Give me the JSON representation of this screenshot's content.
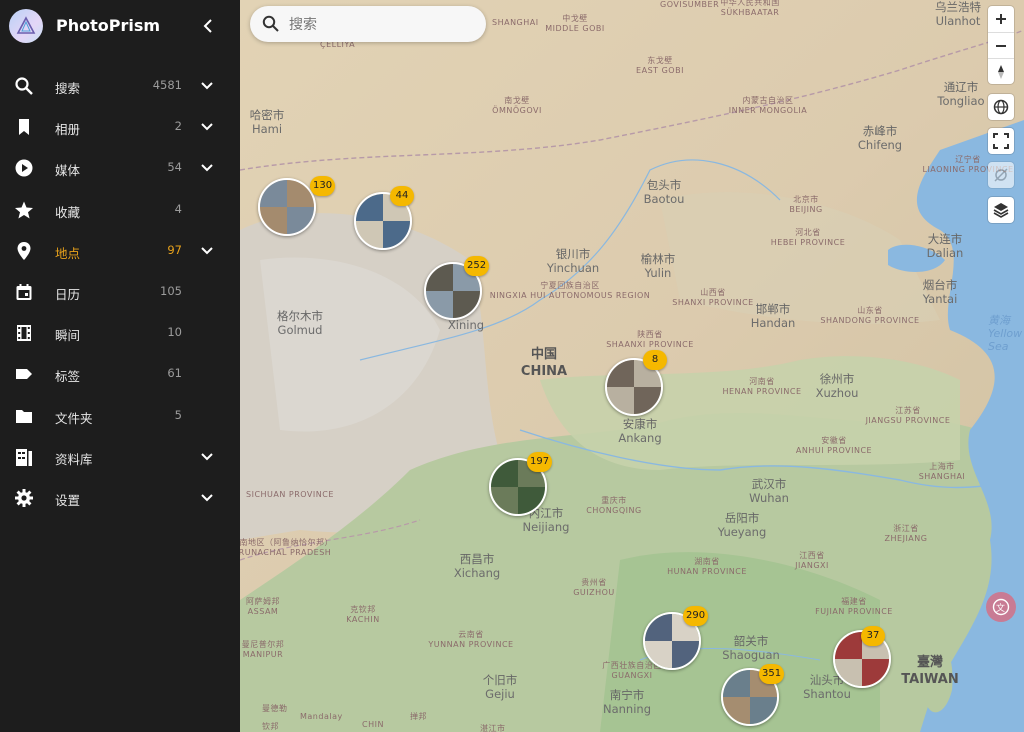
{
  "app": {
    "name": "PhotoPrism"
  },
  "nav": [
    {
      "label": "搜索",
      "count": "4581",
      "icon": "search-icon",
      "chevron": true
    },
    {
      "label": "相册",
      "count": "2",
      "icon": "bookmark-icon",
      "chevron": true
    },
    {
      "label": "媒体",
      "count": "54",
      "icon": "play-circle-icon",
      "chevron": true
    },
    {
      "label": "收藏",
      "count": "4",
      "icon": "star-icon",
      "chevron": false
    },
    {
      "label": "地点",
      "count": "97",
      "icon": "map-marker-icon",
      "chevron": true,
      "active": true
    },
    {
      "label": "日历",
      "count": "105",
      "icon": "calendar-icon",
      "chevron": false
    },
    {
      "label": "瞬间",
      "count": "10",
      "icon": "film-icon",
      "chevron": false
    },
    {
      "label": "标签",
      "count": "61",
      "icon": "label-icon",
      "chevron": false
    },
    {
      "label": "文件夹",
      "count": "5",
      "icon": "folder-icon",
      "chevron": false
    },
    {
      "label": "资料库",
      "count": "",
      "icon": "library-icon",
      "chevron": true
    },
    {
      "label": "设置",
      "count": "",
      "icon": "gear-icon",
      "chevron": true
    }
  ],
  "search": {
    "placeholder": "搜索"
  },
  "map": {
    "places": [
      {
        "zh": "哈密市",
        "en": "Hami"
      },
      {
        "zh": "格尔木市",
        "en": "Golmud"
      },
      {
        "zh": "银川市",
        "en": "Yinchuan"
      },
      {
        "zh": "包头市",
        "en": "Baotou"
      },
      {
        "zh": "榆林市",
        "en": "Yulin"
      },
      {
        "zh": "赤峰市",
        "en": "Chifeng"
      },
      {
        "zh": "大连市",
        "en": "Dalian"
      },
      {
        "zh": "烟台市",
        "en": "Yantai"
      },
      {
        "zh": "邯郸市",
        "en": "Handan"
      },
      {
        "zh": "徐州市",
        "en": "Xuzhou"
      },
      {
        "zh": "安康市",
        "en": "Ankang"
      },
      {
        "zh": "武汉市",
        "en": "Wuhan"
      },
      {
        "zh": "岳阳市",
        "en": "Yueyang"
      },
      {
        "zh": "内江市",
        "en": "Neijiang"
      },
      {
        "zh": "西昌市",
        "en": "Xichang"
      },
      {
        "zh": "韶关市",
        "en": "Shaoguan"
      },
      {
        "zh": "汕头市",
        "en": "Shantou"
      },
      {
        "zh": "南宁市",
        "en": "Nanning"
      },
      {
        "zh": "个旧市",
        "en": "Gejiu"
      },
      {
        "zh": "通辽市",
        "en": "Tongliao"
      },
      {
        "zh": "乌兰浩特",
        "en": "Ulanhot"
      }
    ],
    "partial_places": [
      {
        "zh": "",
        "en": "Xining"
      }
    ],
    "provinces": [
      {
        "zh": "中华人民共和国",
        "en": "SÜKHBAATAR"
      },
      {
        "zh": "中戈壁",
        "en": "MIDDLE GOBI"
      },
      {
        "zh": "东戈壁",
        "en": "EAST GOBI"
      },
      {
        "zh": "南戈壁",
        "en": "ÖMNÖGOVI"
      },
      {
        "zh": "内蒙古自治区",
        "en": "INNER MONGOLIA"
      },
      {
        "zh": "宁夏回族自治区",
        "en": "NINGXIA HUI AUTONOMOUS REGION"
      },
      {
        "zh": "山西省",
        "en": "SHANXI PROVINCE"
      },
      {
        "zh": "陕西省",
        "en": "SHAANXI PROVINCE"
      },
      {
        "zh": "北京市",
        "en": "BEIJING"
      },
      {
        "zh": "河北省",
        "en": "HEBEI PROVINCE"
      },
      {
        "zh": "山东省",
        "en": "SHANDONG PROVINCE"
      },
      {
        "zh": "河南省",
        "en": "HENAN PROVINCE"
      },
      {
        "zh": "江苏省",
        "en": "JIANGSU PROVINCE"
      },
      {
        "zh": "安徽省",
        "en": "ANHUI PROVINCE"
      },
      {
        "zh": "上海市",
        "en": "SHANGHAI"
      },
      {
        "zh": "重庆市",
        "en": "CHONGQING"
      },
      {
        "zh": "湖南省",
        "en": "HUNAN PROVINCE"
      },
      {
        "zh": "江西省",
        "en": "JIANGXI"
      },
      {
        "zh": "浙江省",
        "en": "ZHEJIANG"
      },
      {
        "zh": "贵州省",
        "en": "GUIZHOU"
      },
      {
        "zh": "福建省",
        "en": "FUJIAN PROVINCE"
      },
      {
        "zh": "云南省",
        "en": "YUNNAN PROVINCE"
      },
      {
        "zh": "广西壮族自治区",
        "en": "GUANGXI"
      },
      {
        "zh": "阿萨姆邦",
        "en": "ASSAM"
      },
      {
        "zh": "克钦邦",
        "en": "KACHIN"
      },
      {
        "zh": "曼尼普尔邦",
        "en": "MANIPUR"
      },
      {
        "zh": "藏南地区（阿鲁纳恰尔邦）",
        "en": "ARUNACHAL PRADESH"
      },
      {
        "zh": "辽宁省",
        "en": "LIAONING PROVINCE"
      }
    ],
    "country": {
      "zh": "中国",
      "en": "CHINA"
    },
    "taiwan": {
      "zh": "臺灣",
      "en": "TAIWAN"
    },
    "sea": {
      "zh": "黄海",
      "en": "Yellow Sea"
    },
    "misc_labels": [
      "SHANGHAI",
      "GOVISUMBER",
      "ÇELLIYA",
      "SICHUAN PROVINCE",
      "曼德勒",
      "Mandalay",
      "钦邦",
      "CHIN",
      "掸邦",
      "湛江市"
    ],
    "clusters": [
      {
        "count": "130"
      },
      {
        "count": "44"
      },
      {
        "count": "252"
      },
      {
        "count": "8"
      },
      {
        "count": "197"
      },
      {
        "count": "290"
      },
      {
        "count": "37"
      },
      {
        "count": "351"
      }
    ]
  },
  "controls": [
    "zoom-in-icon",
    "zoom-out-icon",
    "compass-icon",
    "globe-icon",
    "fullscreen-icon",
    "location-off-icon",
    "layers-icon",
    "translate-icon"
  ],
  "colors": {
    "sidebar": "#1d1d1d",
    "active": "#e8a21b",
    "badge": "#f5b800",
    "water": "#8ab8e0",
    "land": "#d9c9a8",
    "green": "#a9c79a"
  }
}
